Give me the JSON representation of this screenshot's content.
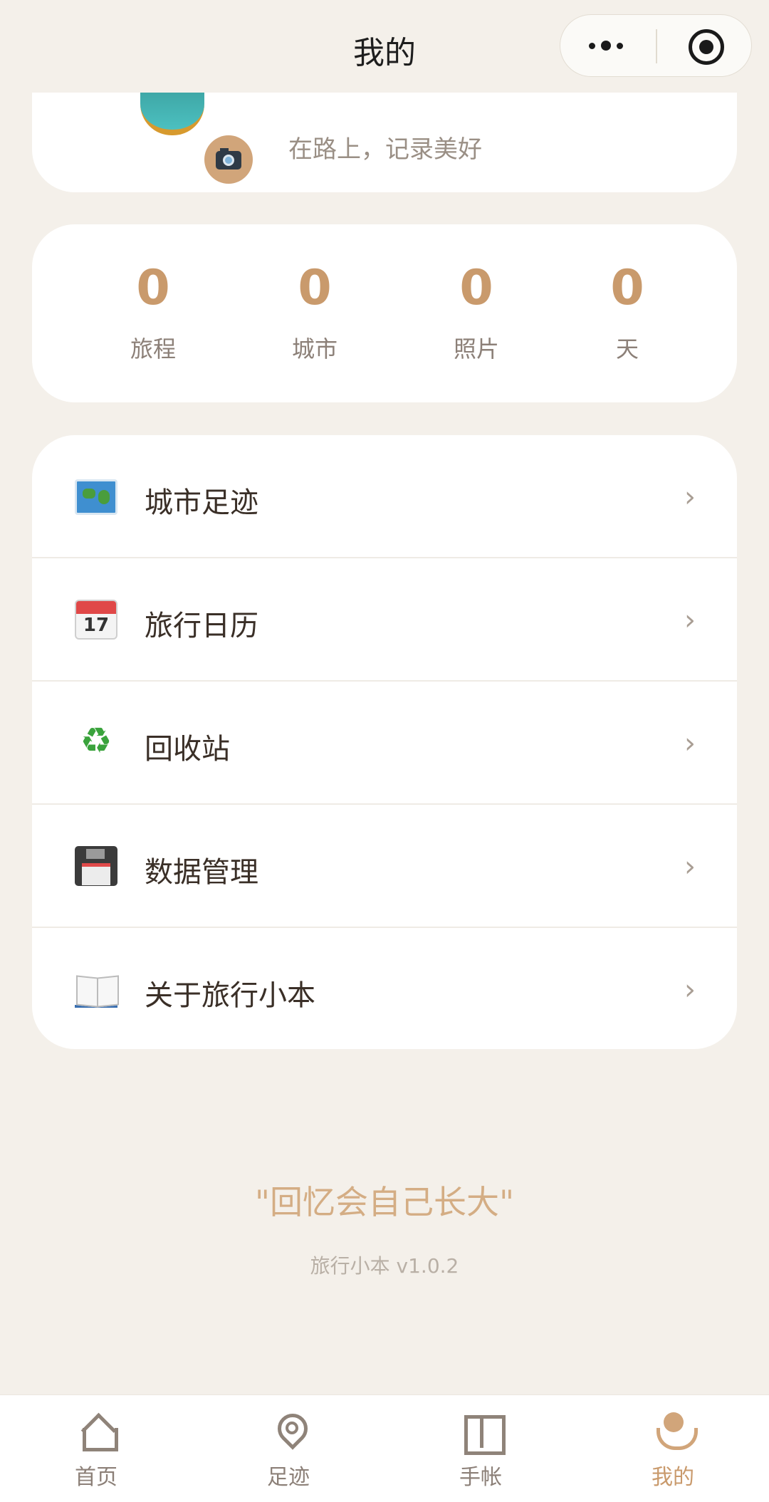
{
  "header": {
    "title": "我的"
  },
  "profile": {
    "motto": "在路上，记录美好"
  },
  "stats": [
    {
      "value": "0",
      "label": "旅程"
    },
    {
      "value": "0",
      "label": "城市"
    },
    {
      "value": "0",
      "label": "照片"
    },
    {
      "value": "0",
      "label": "天"
    }
  ],
  "menu": [
    {
      "icon": "world-map-icon",
      "label": "城市足迹",
      "chevron": "›"
    },
    {
      "icon": "calendar-icon",
      "label": "旅行日历",
      "chevron": "›",
      "icon_text": "17"
    },
    {
      "icon": "recycle-icon",
      "label": "回收站",
      "chevron": "›",
      "icon_text": "♻"
    },
    {
      "icon": "floppy-disk-icon",
      "label": "数据管理",
      "chevron": "›"
    },
    {
      "icon": "open-book-icon",
      "label": "关于旅行小本",
      "chevron": "›"
    }
  ],
  "footer": {
    "quote": "\"回忆会自己长大\"",
    "version": "旅行小本 v1.0.2"
  },
  "tabbar": {
    "items": [
      {
        "icon": "home-icon",
        "label": "首页"
      },
      {
        "icon": "footprint-pin-icon",
        "label": "足迹"
      },
      {
        "icon": "journal-book-icon",
        "label": "手帐"
      },
      {
        "icon": "profile-icon",
        "label": "我的"
      }
    ],
    "active": "我的"
  },
  "colors": {
    "background": "#f4f0ea",
    "accent": "#c99a6c",
    "card": "#ffffff",
    "muted_text": "#8c8078"
  }
}
